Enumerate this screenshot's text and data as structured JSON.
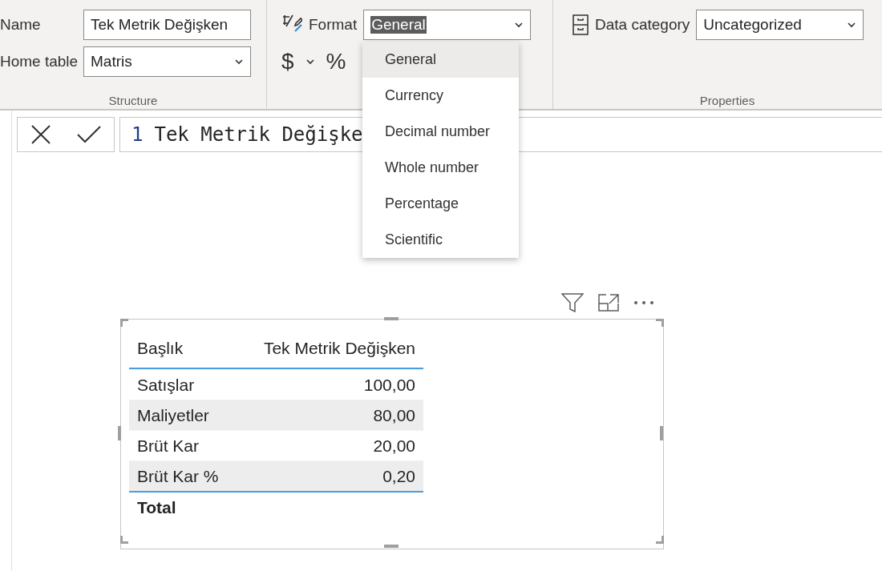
{
  "ribbon": {
    "structure": {
      "name_label": "Name",
      "name_value": "Tek Metrik Değişken",
      "home_table_label": "Home table",
      "home_table_value": "Matris",
      "group_label": "Structure"
    },
    "formatting": {
      "format_label": "Format",
      "format_value": "General",
      "currency_symbol": "$",
      "percent_symbol": "%"
    },
    "properties": {
      "data_category_label": "Data category",
      "data_category_value": "Uncategorized",
      "group_label": "Properties"
    }
  },
  "format_menu": [
    {
      "label": "General",
      "selected": true
    },
    {
      "label": "Currency",
      "selected": false
    },
    {
      "label": "Decimal number",
      "selected": false
    },
    {
      "label": "Whole number",
      "selected": false
    },
    {
      "label": "Percentage",
      "selected": false
    },
    {
      "label": "Scientific",
      "selected": false
    }
  ],
  "formula_bar": {
    "line_number": "1",
    "text": "Tek Metrik Değişke"
  },
  "table": {
    "columns": [
      "Başlık",
      "Tek Metrik Değişken"
    ],
    "rows": [
      [
        "Satışlar",
        "100,00"
      ],
      [
        "Maliyetler",
        "80,00"
      ],
      [
        "Brüt Kar",
        "20,00"
      ],
      [
        "Brüt Kar %",
        "0,20"
      ]
    ],
    "total_label": "Total"
  }
}
